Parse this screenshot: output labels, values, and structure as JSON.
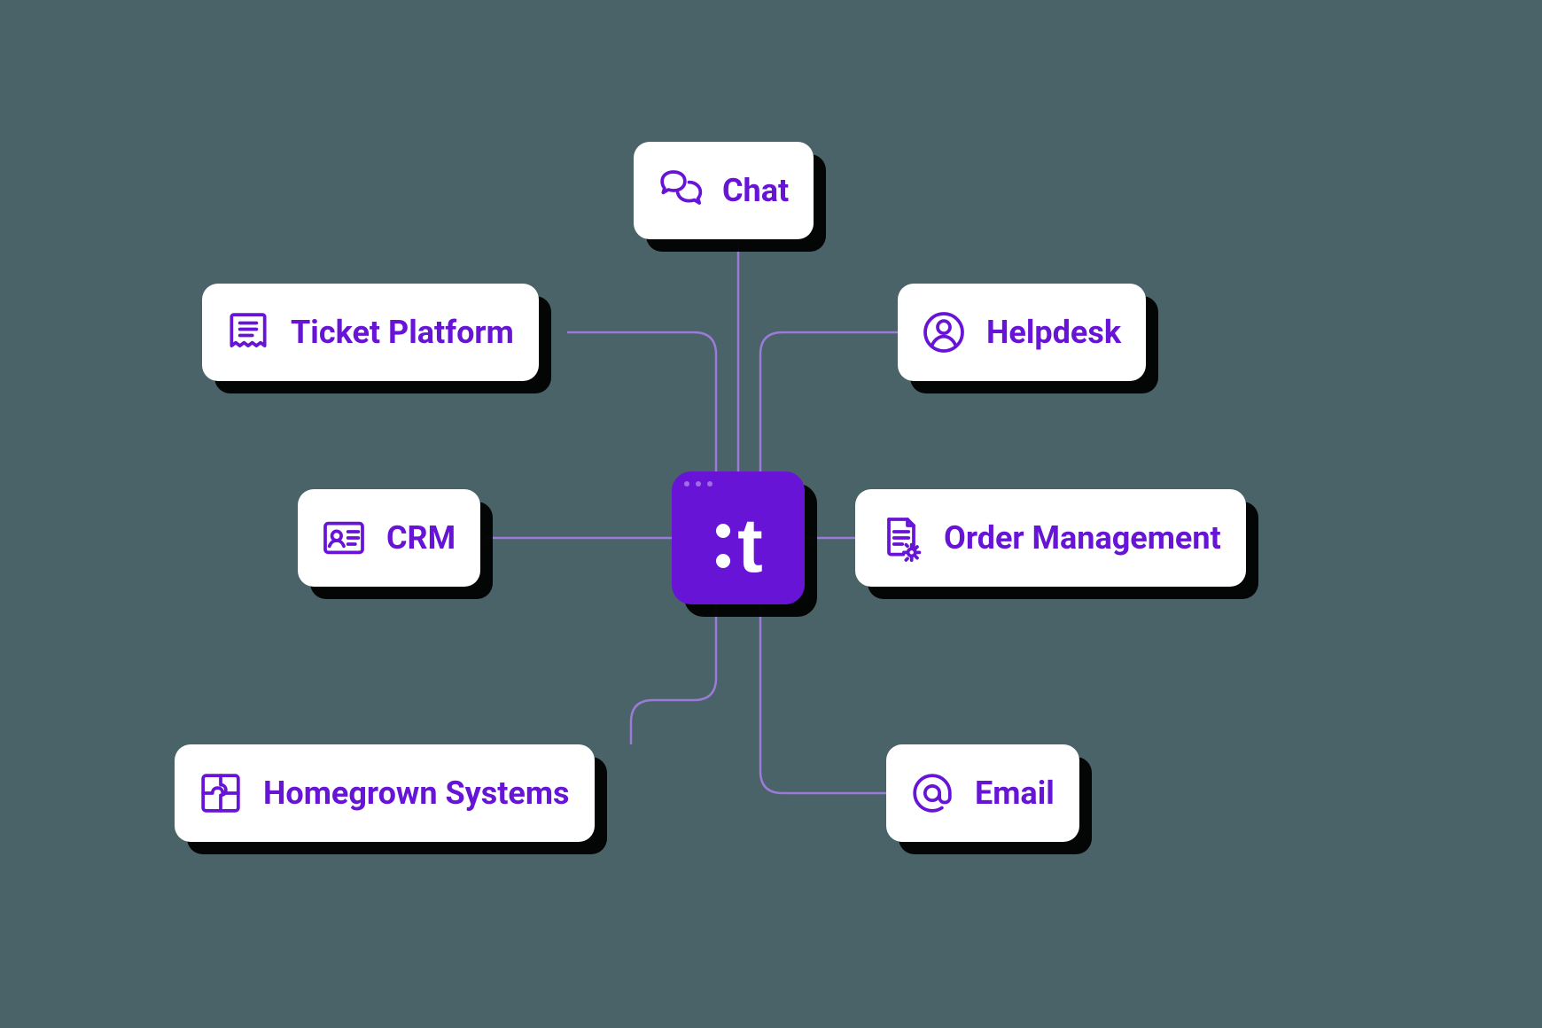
{
  "colors": {
    "background": "#4a6368",
    "accent": "#6714d6",
    "card": "#ffffff",
    "shadow": "#000000"
  },
  "hub": {
    "logo_letter": "t"
  },
  "nodes": {
    "chat": {
      "label": "Chat",
      "icon": "chat-icon"
    },
    "ticket": {
      "label": "Ticket Platform",
      "icon": "ticket-icon"
    },
    "helpdesk": {
      "label": "Helpdesk",
      "icon": "person-icon"
    },
    "crm": {
      "label": "CRM",
      "icon": "id-card-icon"
    },
    "order": {
      "label": "Order Management",
      "icon": "document-gear-icon"
    },
    "homegrown": {
      "label": "Homegrown Systems",
      "icon": "puzzle-icon"
    },
    "email": {
      "label": "Email",
      "icon": "at-sign-icon"
    }
  }
}
